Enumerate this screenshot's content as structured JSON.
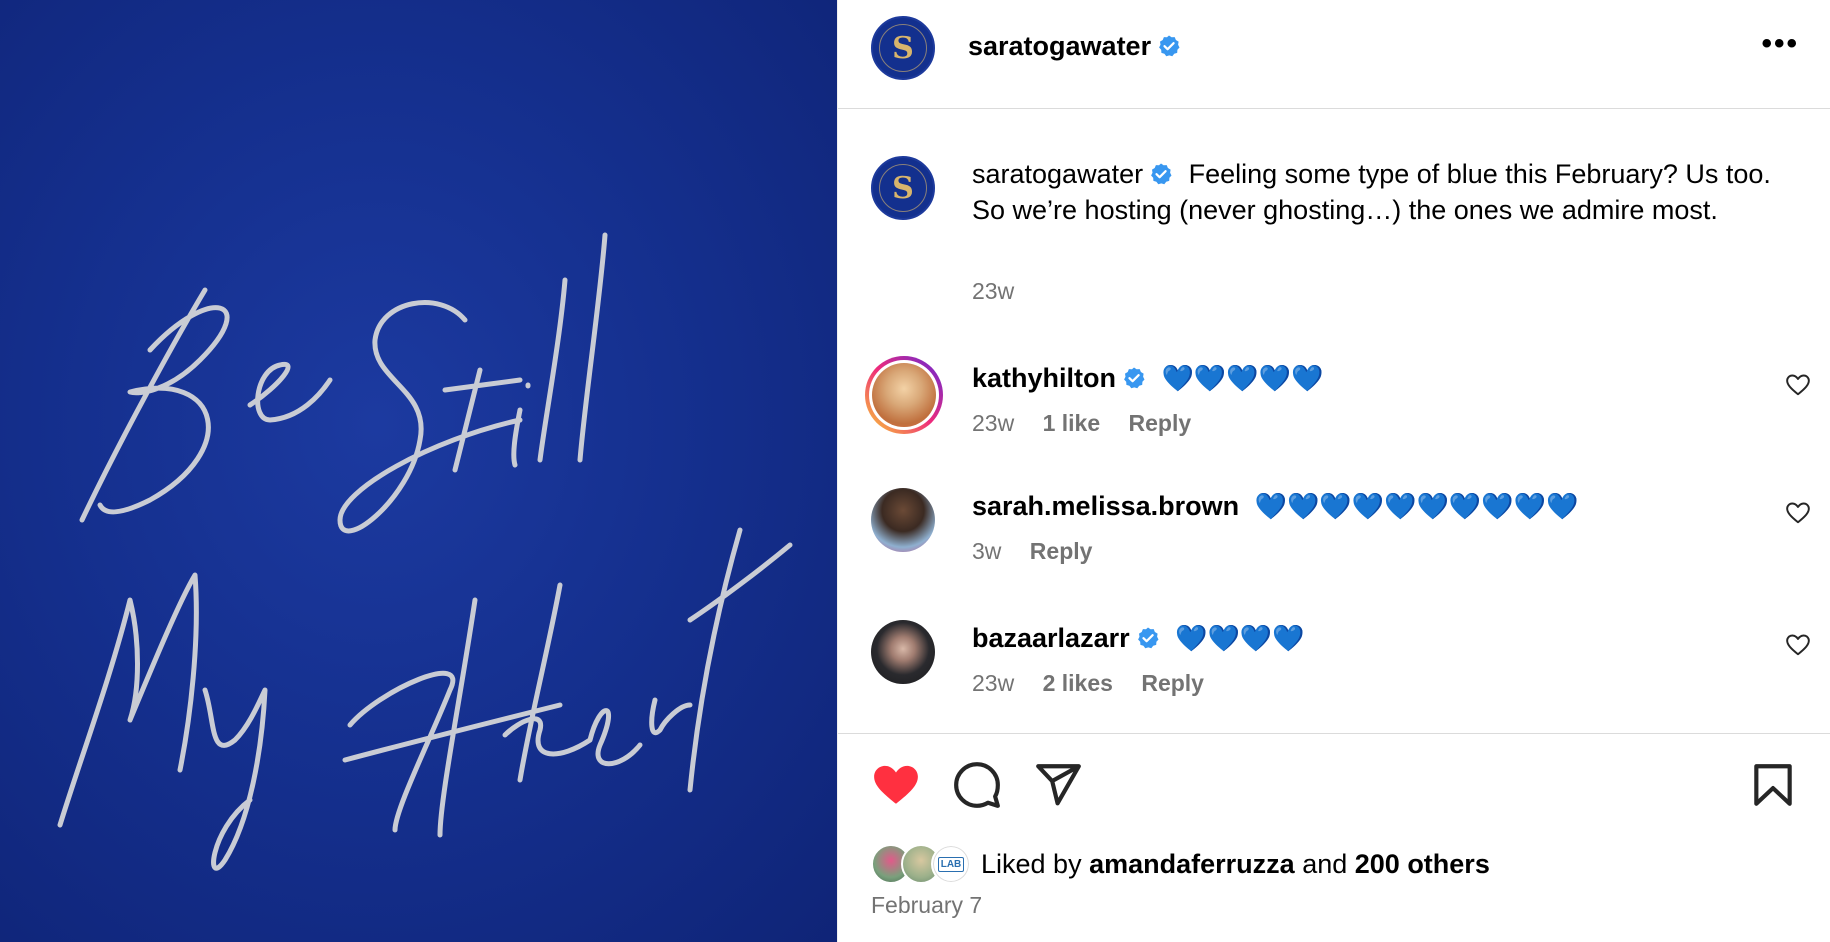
{
  "image": {
    "line1": "Be Still",
    "line2": "My Heart"
  },
  "header": {
    "username": "saratogawater",
    "avatar_letter": "S",
    "more_label": "•••"
  },
  "caption": {
    "username": "saratogawater",
    "avatar_letter": "S",
    "text": "Feeling some type of blue this February? Us too. So we’re hosting (never ghosting…) the ones we admire most.",
    "time": "23w"
  },
  "comments": [
    {
      "username": "kathyhilton",
      "verified": true,
      "text": "💙💙💙💙💙",
      "time": "23w",
      "likes": "1 like",
      "reply": "Reply"
    },
    {
      "username": "sarah.melissa.brown",
      "verified": false,
      "text": "💙💙💙💙💙💙💙💙💙💙",
      "time": "3w",
      "likes": "",
      "reply": "Reply"
    },
    {
      "username": "bazaarlazarr",
      "verified": true,
      "text": "💙💙💙💙",
      "time": "23w",
      "likes": "2 likes",
      "reply": "Reply"
    }
  ],
  "actions": {
    "liked_prefix": "Liked by",
    "liked_user": "amandaferruzza",
    "liked_and": "and",
    "liked_others": "200 others",
    "lab_badge": "LAB",
    "date": "February 7"
  },
  "colors": {
    "image_bg": "#15308f",
    "verified": "#3897f0",
    "like_red": "#ff3040",
    "muted": "#737373"
  }
}
